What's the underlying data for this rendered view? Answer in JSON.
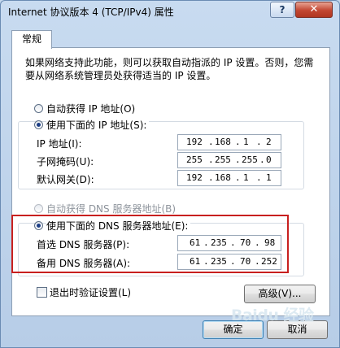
{
  "window": {
    "title": "Internet 协议版本 4 (TCP/IPv4) 属性"
  },
  "titlebar": {
    "help_label": "?",
    "close_label": "✕"
  },
  "tabs": [
    {
      "label": "常规"
    }
  ],
  "description": "如果网络支持此功能，则可以获取自动指派的 IP 设置。否则，您需要从网络系统管理员处获得适当的 IP 设置。",
  "ip": {
    "auto_label": "自动获得 IP 地址(O)",
    "manual_label": "使用下面的 IP 地址(S):",
    "selected": "manual",
    "fields": [
      {
        "label": "IP 地址(I):",
        "octets": [
          "192",
          "168",
          "1",
          "2"
        ]
      },
      {
        "label": "子网掩码(U):",
        "octets": [
          "255",
          "255",
          "255",
          "0"
        ]
      },
      {
        "label": "默认网关(D):",
        "octets": [
          "192",
          "168",
          "1",
          "1"
        ]
      }
    ]
  },
  "dns": {
    "auto_label": "自动获得 DNS 服务器地址(B)",
    "manual_label": "使用下面的 DNS 服务器地址(E):",
    "selected": "manual",
    "fields": [
      {
        "label": "首选 DNS 服务器(P):",
        "octets": [
          "61",
          "235",
          "70",
          "98"
        ]
      },
      {
        "label": "备用 DNS 服务器(A):",
        "octets": [
          "61",
          "235",
          "70",
          "252"
        ]
      }
    ]
  },
  "validate_checkbox": {
    "label": "退出时验证设置(L)",
    "checked": false
  },
  "buttons": {
    "advanced": "高级(V)...",
    "ok": "确定",
    "cancel": "取消"
  },
  "watermark": "Baidu 经验",
  "colors": {
    "highlight_border": "#c8201f",
    "title_bg": "#c8dbf0",
    "close_button": "#c24631"
  }
}
